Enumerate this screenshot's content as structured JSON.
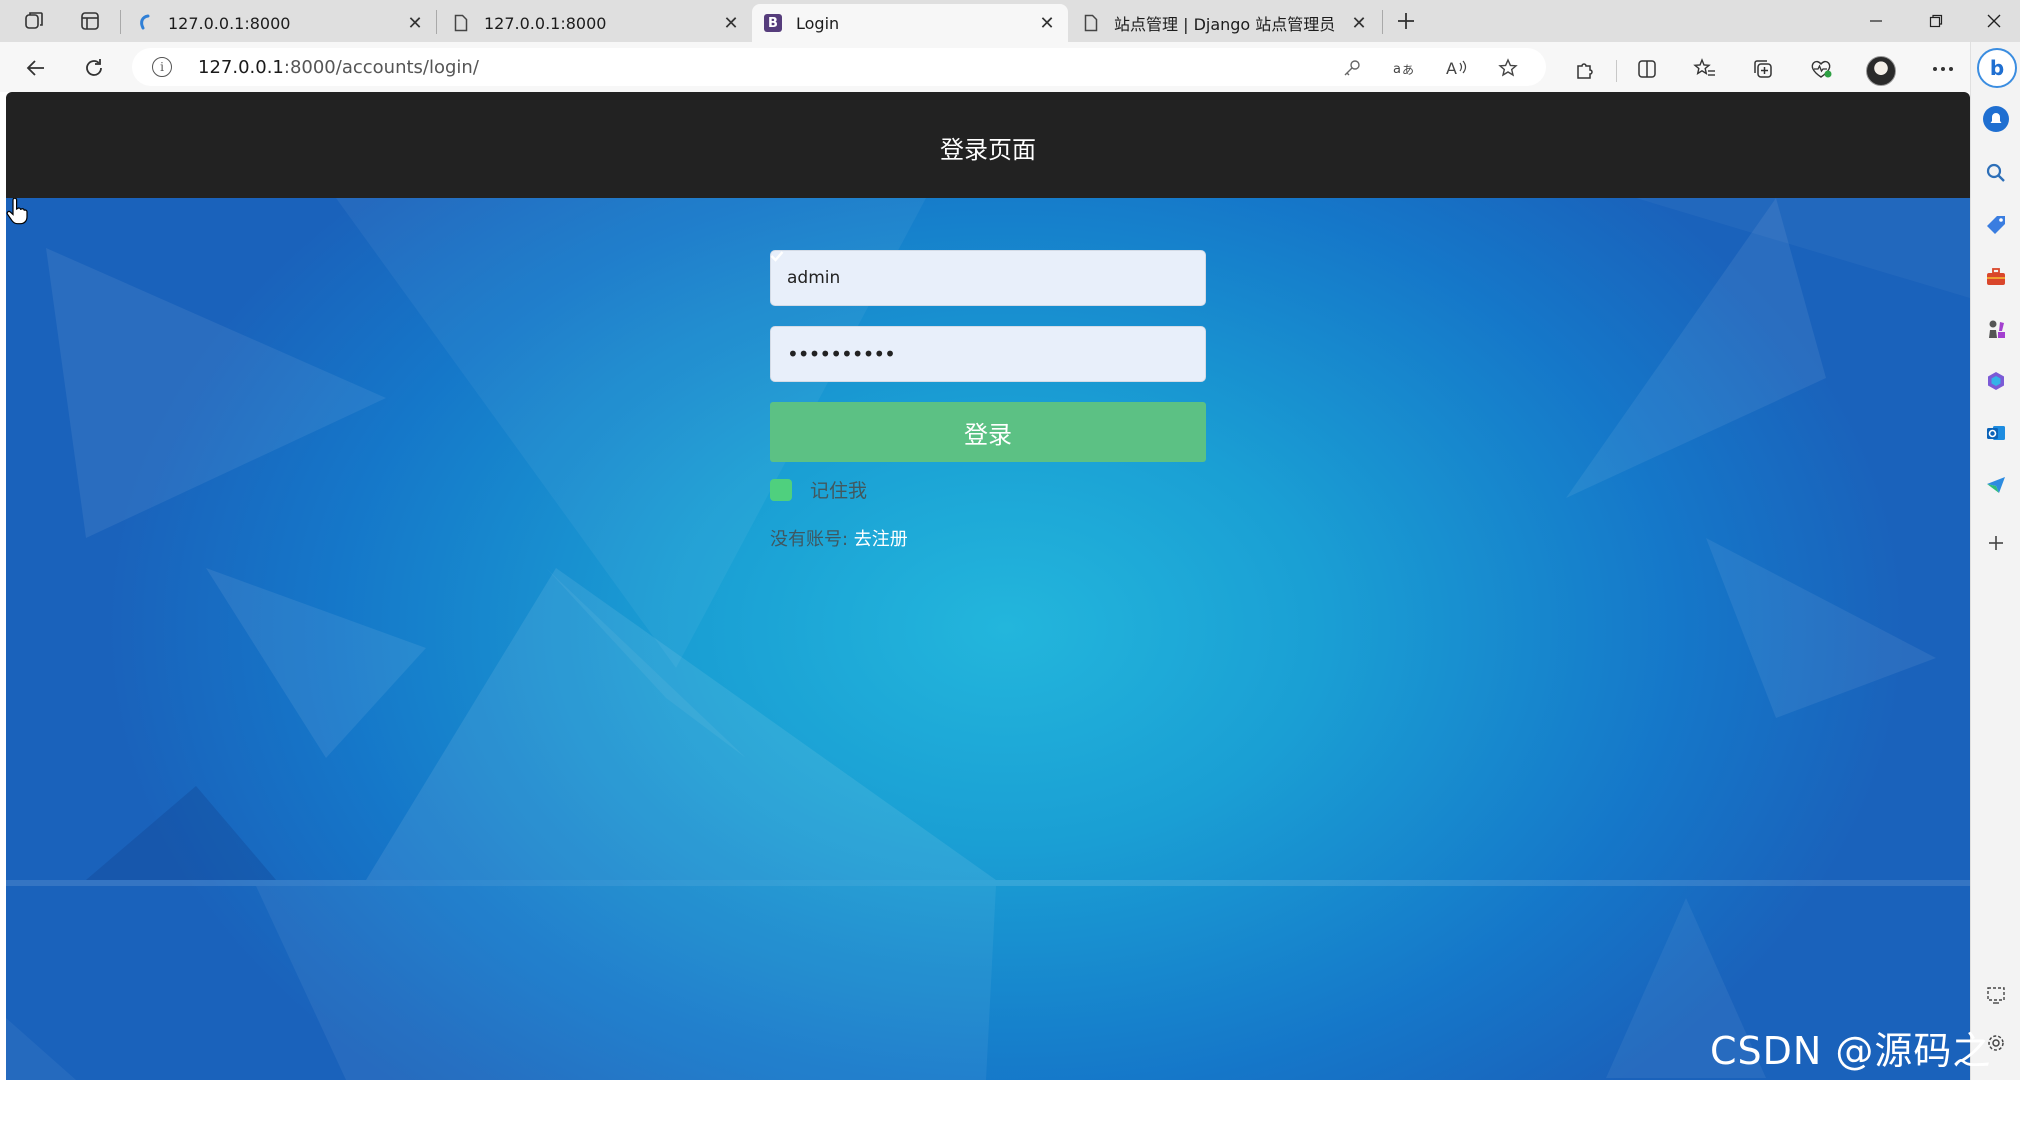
{
  "browser": {
    "tabs": [
      {
        "title": "127.0.0.1:8000",
        "favicon": "django-swirl-icon",
        "active": false
      },
      {
        "title": "127.0.0.1:8000",
        "favicon": "page-icon",
        "active": false
      },
      {
        "title": "Login",
        "favicon": "bootstrap-icon",
        "favicon_letter": "B",
        "active": true
      },
      {
        "title": "站点管理 | Django 站点管理员",
        "favicon": "page-icon",
        "active": false
      }
    ],
    "url_host": "127.0.0.1",
    "url_rest": ":8000/accounts/login/",
    "close_glyph": "✕"
  },
  "page": {
    "navbar_title": "登录页面",
    "username_value": "admin",
    "password_mask": "••••••••••",
    "login_button": "登录",
    "remember_label": "记住我",
    "remember_checked": true,
    "signup_prompt": "没有账号: ",
    "signup_link": "去注册",
    "colors": {
      "navbar": "#222222",
      "button": "#5cc184",
      "checkbox": "#4fd07e"
    }
  },
  "watermark": "CSDN @源码之家"
}
